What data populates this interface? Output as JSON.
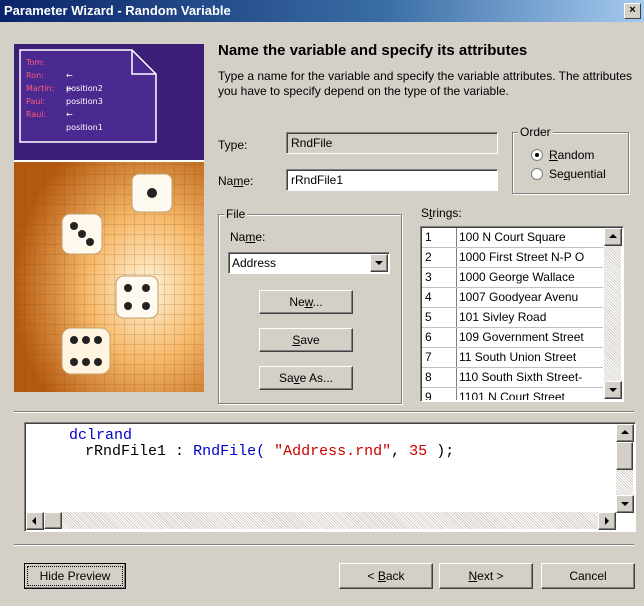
{
  "window": {
    "title": "Parameter Wizard - Random Variable",
    "close_glyph": "×"
  },
  "picture": {
    "names": [
      {
        "name": "Tom:",
        "note": ""
      },
      {
        "name": "Ron:",
        "note": "← position2"
      },
      {
        "name": "Martin:",
        "note": "← position3"
      },
      {
        "name": "Paul:",
        "note": ""
      },
      {
        "name": "Raul:",
        "note": "← position1"
      }
    ]
  },
  "header": {
    "heading": "Name the variable and specify its attributes",
    "description": "Type a name for the variable and specify the variable attributes. The attributes you have to specify depend on the type of the variable."
  },
  "form": {
    "type_label": "Type:",
    "type_value": "RndFile",
    "name_label_pre": "Na",
    "name_label_u": "m",
    "name_label_post": "e:",
    "name_value": "rRndFile1"
  },
  "order": {
    "label": "Order",
    "random_u": "R",
    "random_rest": "andom",
    "sequential_pre": "Se",
    "sequential_u": "q",
    "sequential_post": "uential",
    "selected": "random"
  },
  "file": {
    "label": "File",
    "name_label_pre": "Na",
    "name_label_u": "m",
    "name_label_post": "e:",
    "selected": "Address",
    "new_pre": "Ne",
    "new_u": "w",
    "new_post": "...",
    "save_u": "S",
    "save_post": "ave",
    "saveas_pre": "Sa",
    "saveas_u": "v",
    "saveas_post": "e As..."
  },
  "strings": {
    "label_pre": "S",
    "label_u": "t",
    "label_post": "rings:",
    "rows": [
      {
        "n": "1",
        "v": "100 N Court Square"
      },
      {
        "n": "2",
        "v": "1000 First Street N-P O"
      },
      {
        "n": "3",
        "v": "1000 George Wallace"
      },
      {
        "n": "4",
        "v": "1007 Goodyear Avenu"
      },
      {
        "n": "5",
        "v": "101 Sivley Road"
      },
      {
        "n": "6",
        "v": "109 Government Street"
      },
      {
        "n": "7",
        "v": "11 South Union Street"
      },
      {
        "n": "8",
        "v": "110 South Sixth Street-"
      },
      {
        "n": "9",
        "v": "1101 N Court Street"
      }
    ]
  },
  "preview": {
    "keyword": "dclrand",
    "varname": "rRndFile1",
    "colon": ":",
    "func": "RndFile(",
    "arg1": "\"Address.rnd\"",
    "comma": ",",
    "arg2": "35",
    "close": ");"
  },
  "footer": {
    "hide_preview": "Hide Preview",
    "back_pre": "< ",
    "back_u": "B",
    "back_post": "ack",
    "next_u": "N",
    "next_post": "ext >",
    "cancel": "Cancel"
  },
  "colors": {
    "title_start": "#0a246a",
    "keyword": "#0000cc",
    "string": "#cc0000",
    "accent_purple": "#3b1e78"
  }
}
